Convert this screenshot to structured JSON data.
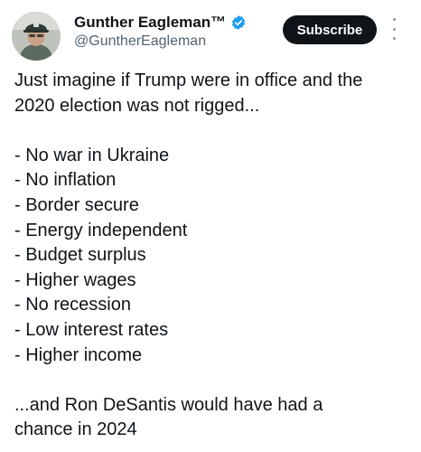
{
  "author": {
    "display_name": "Gunther Eagleman™",
    "handle": "@GuntherEagleman",
    "verified": true,
    "verified_color": "#1d9bf0"
  },
  "actions": {
    "subscribe_label": "Subscribe",
    "more_icon": "more-vertical-icon"
  },
  "tweet": {
    "intro_lines": [
      "Just imagine if Trump were in office and the",
      "2020 election was not rigged..."
    ],
    "list_items": [
      "- No war in Ukraine",
      "- No inflation",
      "- Border secure",
      "- Energy independent",
      "- Budget surplus",
      "- Higher wages",
      "- No recession",
      "- Low interest rates",
      "- Higher income"
    ],
    "outro_lines": [
      "...and Ron DeSantis would have had a",
      "chance in 2024"
    ]
  },
  "colors": {
    "text": "#0f1419",
    "secondary_text": "#536471",
    "button_bg": "#0f1419",
    "button_text": "#ffffff"
  }
}
